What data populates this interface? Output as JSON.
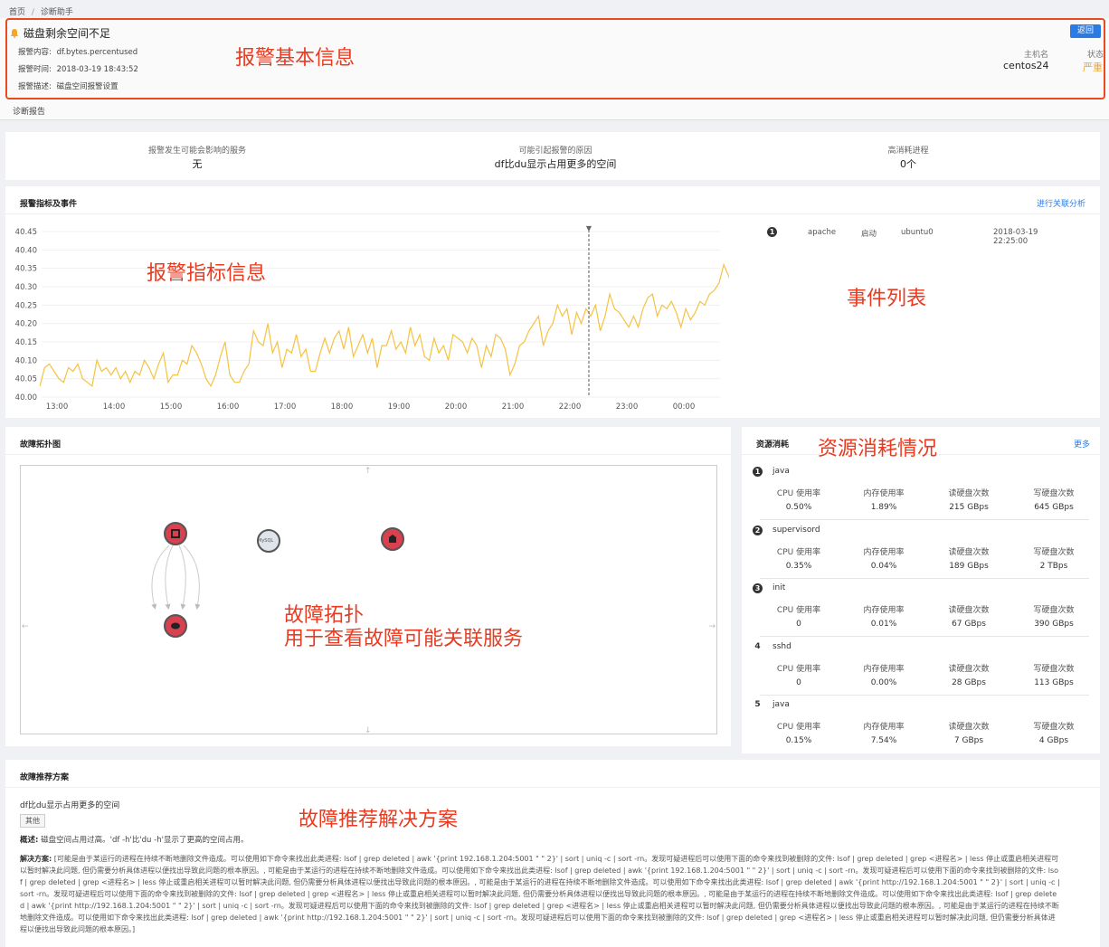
{
  "breadcrumb": {
    "home": "首页",
    "sep": "/",
    "current": "诊断助手"
  },
  "alert": {
    "title": "磁盘剩余空间不足",
    "back_label": "返回",
    "content_label": "报警内容:",
    "content_value": "df.bytes.percentused",
    "time_label": "报警时间:",
    "time_value": "2018-03-19 18:43:52",
    "desc_label": "报警描述:",
    "desc_value": "磁盘空间报警设置",
    "host_label": "主机名",
    "host_value": "centos24",
    "status_label": "状态",
    "status_value": "严重",
    "status_color": "#f5a623"
  },
  "tabs": {
    "report": "诊断报告"
  },
  "summary": {
    "services_label": "报警发生可能会影响的服务",
    "services_value": "无",
    "cause_label": "可能引起报警的原因",
    "cause_value": "df比du显示占用更多的空间",
    "process_label": "高消耗进程",
    "process_value": "0个"
  },
  "metrics": {
    "title": "报警指标及事件",
    "link": "进行关联分析",
    "marker": "▼"
  },
  "events": [
    {
      "index": "1",
      "service": "apache",
      "action": "启动",
      "host": "ubuntu0",
      "time": "2018-03-19 22:25:00"
    }
  ],
  "chart_data": {
    "type": "line",
    "title": "",
    "xlabel": "",
    "ylabel": "",
    "ylim": [
      40.0,
      40.45
    ],
    "yticks": [
      "40.00",
      "40.05",
      "40.10",
      "40.15",
      "40.20",
      "40.25",
      "40.30",
      "40.35",
      "40.40",
      "40.45"
    ],
    "xticks": [
      "13:00",
      "14:00",
      "15:00",
      "16:00",
      "17:00",
      "18:00",
      "19:00",
      "20:00",
      "21:00",
      "22:00",
      "23:00",
      "00:00"
    ],
    "x_start_hour": 12.7,
    "x_step_minutes": 5,
    "marker_time": "22:20",
    "color": "#f5c242",
    "series": [
      {
        "name": "",
        "values": [
          40.03,
          40.08,
          40.09,
          40.07,
          40.05,
          40.04,
          40.08,
          40.07,
          40.09,
          40.05,
          40.04,
          40.03,
          40.1,
          40.07,
          40.08,
          40.06,
          40.08,
          40.05,
          40.07,
          40.04,
          40.07,
          40.06,
          40.1,
          40.08,
          40.05,
          40.09,
          40.12,
          40.04,
          40.06,
          40.06,
          40.1,
          40.09,
          40.14,
          40.12,
          40.09,
          40.05,
          40.03,
          40.06,
          40.11,
          40.15,
          40.06,
          40.04,
          40.04,
          40.07,
          40.09,
          40.18,
          40.15,
          40.14,
          40.2,
          40.12,
          40.15,
          40.08,
          40.13,
          40.12,
          40.17,
          40.11,
          40.13,
          40.07,
          40.07,
          40.12,
          40.16,
          40.12,
          40.16,
          40.18,
          40.13,
          40.19,
          40.11,
          40.14,
          40.17,
          40.12,
          40.16,
          40.08,
          40.14,
          40.14,
          40.18,
          40.13,
          40.15,
          40.12,
          40.19,
          40.14,
          40.17,
          40.11,
          40.1,
          40.16,
          40.12,
          40.14,
          40.1,
          40.17,
          40.16,
          40.15,
          40.12,
          40.16,
          40.14,
          40.08,
          40.14,
          40.11,
          40.17,
          40.16,
          40.13,
          40.06,
          40.09,
          40.14,
          40.15,
          40.18,
          40.2,
          40.22,
          40.14,
          40.18,
          40.2,
          40.25,
          40.22,
          40.24,
          40.17,
          40.23,
          40.2,
          40.24,
          40.22,
          40.25,
          40.18,
          40.22,
          40.28,
          40.24,
          40.23,
          40.21,
          40.19,
          40.22,
          40.19,
          40.24,
          40.27,
          40.28,
          40.22,
          40.25,
          40.24,
          40.26,
          40.23,
          40.19,
          40.24,
          40.21,
          40.23,
          40.26,
          40.25,
          40.28,
          40.29,
          40.31,
          40.36,
          40.33,
          40.3,
          40.34,
          40.32,
          40.36,
          40.35,
          40.33,
          40.31,
          40.36,
          40.34,
          40.37,
          40.35,
          40.38,
          40.42,
          40.38,
          40.34,
          40.36,
          40.35,
          40.38,
          40.39,
          40.36,
          40.37,
          40.39,
          40.38,
          40.35,
          40.27,
          40.32,
          40.3,
          40.34,
          40.29,
          40.23,
          40.27,
          40.32,
          40.3,
          40.33,
          40.37,
          40.34,
          40.36,
          40.35,
          40.32,
          40.38,
          40.34,
          40.31,
          40.29,
          40.26,
          40.27,
          40.3,
          40.34,
          40.33,
          40.35,
          40.34,
          40.37,
          40.41,
          40.36,
          40.29,
          40.25,
          40.27
        ]
      }
    ]
  },
  "topology": {
    "title": "故障拓扑图",
    "mysql_label": "MySQL"
  },
  "resources": {
    "title": "资源消耗",
    "more": "更多",
    "col1": "CPU 使用率",
    "col2": "内存使用率",
    "col3": "读硬盘次数",
    "col4": "写硬盘次数",
    "items": [
      {
        "index": "1",
        "name": "java",
        "cpu": "0.50%",
        "mem": "1.89%",
        "read": "215 GBps",
        "write": "645 GBps"
      },
      {
        "index": "2",
        "name": "supervisord",
        "cpu": "0.35%",
        "mem": "0.04%",
        "read": "189 GBps",
        "write": "2 TBps"
      },
      {
        "index": "3",
        "name": "init",
        "cpu": "0",
        "mem": "0.01%",
        "read": "67 GBps",
        "write": "390 GBps"
      },
      {
        "index": "4",
        "name": "sshd",
        "cpu": "0",
        "mem": "0.00%",
        "read": "28 GBps",
        "write": "113 GBps"
      },
      {
        "index": "5",
        "name": "java",
        "cpu": "0.15%",
        "mem": "7.54%",
        "read": "7 GBps",
        "write": "4 GBps"
      }
    ]
  },
  "solution": {
    "title": "故障推荐方案",
    "problem": "df比du显示占用更多的空间",
    "tag": "其他",
    "overview_label": "概述:",
    "overview_value": "磁盘空间占用过高。'df -h'比'du -h'显示了更高的空间占用。",
    "plan_label": "解决方案:",
    "plan_value": "[可能是由于某运行的进程在持续不断地删除文件造成。可以使用如下命令来找出此类进程: lsof | grep deleted | awk '{print 192.168.1.204:5001 \" \" 2}' | sort | uniq -c | sort -rn。发现可疑进程后可以使用下面的命令来找到被删除的文件: lsof | grep deleted | grep <进程名> | less 停止或重启相关进程可以暂时解决此问题, 但仍需要分析具体进程以便找出导致此问题的根本原因。, 可能是由于某运行的进程在持续不断地删除文件造成。可以使用如下命令来找出此类进程: lsof | grep deleted | awk '{print 192.168.1.204:5001 \" \" 2}' | sort | uniq -c | sort -rn。发现可疑进程后可以使用下面的命令来找到被删除的文件: lsof | grep deleted | grep <进程名> | less 停止或重启相关进程可以暂时解决此问题, 但仍需要分析具体进程以便找出导致此问题的根本原因。, 可能是由于某运行的进程在持续不断地删除文件造成。可以使用如下命令来找出此类进程: lsof | grep deleted | awk '{print http://192.168.1.204:5001 \" \" 2}' | sort | uniq -c | sort -rn。发现可疑进程后可以使用下面的命令来找到被删除的文件: lsof | grep deleted | grep <进程名> | less 停止或重启相关进程可以暂时解决此问题, 但仍需要分析具体进程以便找出导致此问题的根本原因。, 可能是由于某运行的进程在持续不断地删除文件造成。可以使用如下命令来找出此类进程: lsof | grep deleted | awk '{print http://192.168.1.204:5001 \" \" 2}' | sort | uniq -c | sort -rn。发现可疑进程后可以使用下面的命令来找到被删除的文件: lsof | grep deleted | grep <进程名> | less 停止或重启相关进程可以暂时解决此问题, 但仍需要分析具体进程以便找出导致此问题的根本原因。, 可能是由于某运行的进程在持续不断地删除文件造成。可以使用如下命令来找出此类进程: lsof | grep deleted | awk '{print http://192.168.1.204:5001 \" \" 2}' | sort | uniq -c | sort -rn。发现可疑进程后可以使用下面的命令来找到被删除的文件: lsof | grep deleted | grep <进程名> | less 停止或重启相关进程可以暂时解决此问题, 但仍需要分析具体进程以便找出导致此问题的根本原因。]"
  },
  "annotations": {
    "basic": "报警基本信息",
    "metric": "报警指标信息",
    "events": "事件列表",
    "resource": "资源消耗情况",
    "topo1": "故障拓扑",
    "topo2": "用于查看故障可能关联服务",
    "solution": "故障推荐解决方案",
    "color": "#ea3a1f"
  }
}
